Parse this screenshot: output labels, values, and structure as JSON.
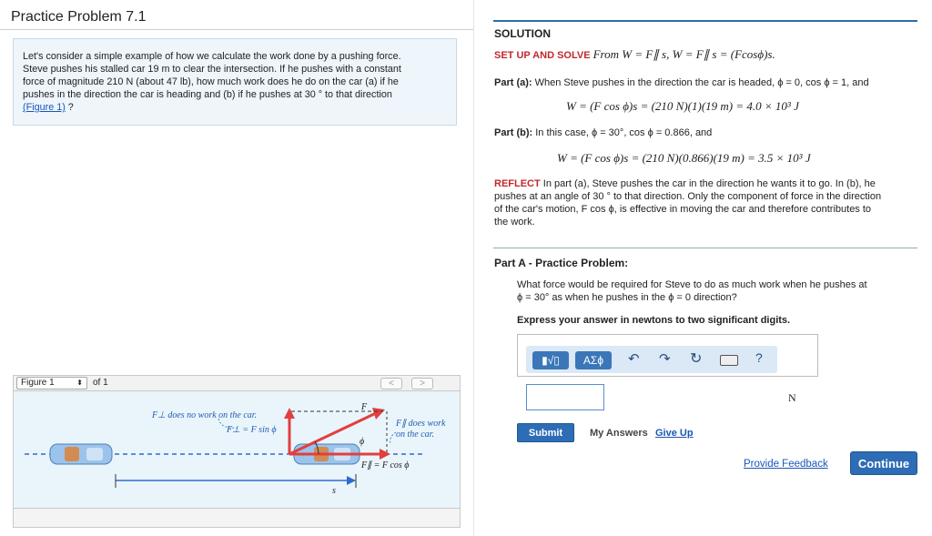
{
  "page": {
    "title": "Practice Problem 7.1"
  },
  "problem": {
    "line1": "Let's consider a simple example of how we calculate the work done by a pushing force.",
    "line2": "Steve pushes his stalled car 19 m to clear the intersection. If he pushes with a constant",
    "line3": "force of magnitude 210 N (about 47 lb), how much work does he do on the car (a) if he",
    "line4": "pushes in the direction the car is heading and (b) if he pushes at 30 ° to that direction",
    "link": "(Figure 1)",
    "suffix": " ?"
  },
  "figure": {
    "selected": "Figure 1",
    "of": "of 1",
    "prev": "<",
    "next": ">",
    "labels": {
      "no_work": "F⊥ does no work on the car.",
      "perp_eq": "F⊥ = F sin ϕ",
      "force": "F",
      "angle": "ϕ",
      "par_work1": "F∥ does work",
      "par_work2": "on the car.",
      "par_eq": "F∥ = F cos ϕ",
      "disp": "s"
    }
  },
  "solution": {
    "heading": "SOLUTION",
    "setup_label": "SET UP AND SOLVE",
    "setup_text": "From W = F∥ s, W = F∥ s = (Fcosϕ)s.",
    "part_a_label": "Part (a):",
    "part_a_text": "When Steve pushes in the direction the car is headed, ϕ = 0, cos ϕ = 1, and",
    "part_a_eq": "W = (F cos ϕ)s = (210 N)(1)(19 m) = 4.0 × 10³ J",
    "part_b_label": "Part (b):",
    "part_b_text": "In this case, ϕ = 30°, cos ϕ = 0.866, and",
    "part_b_eq": "W = (F cos ϕ)s = (210 N)(0.866)(19 m) = 3.5 × 10³ J",
    "reflect_label": "REFLECT",
    "reflect_1": "In part (a), Steve pushes the car in the direction he wants it to go. In (b), he",
    "reflect_2": "pushes at an angle of 30 ° to that direction. Only the component of force in the direction",
    "reflect_3": "of the car's motion, F cos ϕ, is effective in moving the car and therefore contributes to",
    "reflect_4": "the work."
  },
  "practice": {
    "heading": "Part A - Practice Problem:",
    "question_1": "What force would be required for Steve to do as much work when he pushes at",
    "question_2": "ϕ = 30°  as when he pushes in the ϕ = 0 direction?",
    "instruction": "Express your answer in newtons to two significant digits.",
    "toolbar": {
      "templates": "▮√▯",
      "symbols": "ΑΣϕ",
      "help": "?"
    },
    "answer_value": "",
    "unit": "N",
    "submit": "Submit",
    "my_answers": "My Answers",
    "give_up": "Give Up",
    "feedback": "Provide Feedback",
    "continue": "Continue"
  },
  "colors": {
    "accent": "#2d6db5",
    "reflect_red": "#c0282d",
    "problem_bg": "#eef5fb",
    "figure_bg": "#eaf4fb"
  }
}
